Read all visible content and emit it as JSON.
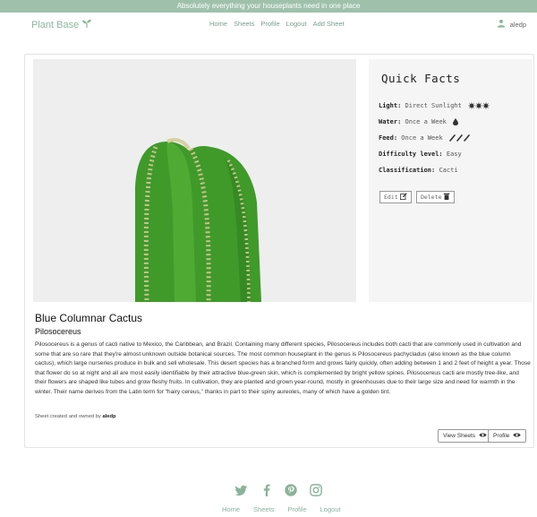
{
  "banner": {
    "text": "Absolutely everything your houseplants need in one place"
  },
  "navbar": {
    "brand": "Plant Base",
    "links": [
      "Home",
      "Sheets",
      "Profile",
      "Logout",
      "Add Sheet"
    ],
    "username": "aledp"
  },
  "facts": {
    "title": "Quick Facts",
    "light_label": "Light:",
    "light_value": "Direct Sunlight",
    "water_label": "Water:",
    "water_value": "Once a Week",
    "feed_label": "Feed:",
    "feed_value": "Once a Week",
    "difficulty_label": "Difficulty level:",
    "difficulty_value": "Easy",
    "classification_label": "Classification:",
    "classification_value": "Cacti",
    "edit_label": "Edit",
    "delete_label": "Delete"
  },
  "plant": {
    "name": "Blue Columnar Cactus",
    "latin": "Pilosocereus",
    "description": "Pilosocereus is a genus of cacti native to Mexico, the Caribbean, and Brazil. Containing many different species, Pilosocereus includes both cacti that are commonly used in cultivation and some that are so rare that they're almost unknown outside botanical sources. The most common houseplant in the genus is Pilosocereus pachycladus (also known as the blue column cactus), which large nurseries produce in bulk and sell wholesale. This desert species has a branched form and grows fairly quickly, often adding between 1 and 2 feet of height a year. Those that flower do so at night and all are most easily identifiable by their attractive blue-green skin, which is complemented by bright yellow spines. Pilosocereus cacti are mostly tree-like, and their flowers are shaped like tubes and grow fleshy fruits. In cultivation, they are planted and grown year-round, mostly in greenhouses due to their large size and need for warmth in the winter. Their name derives from the Latin term for “hairy cereus,” thanks in part to their spiny aureoles, many of which have a golden tint.",
    "owner_prefix": "Sheet created and owned by",
    "owner": "aledp"
  },
  "actions": {
    "view_sheets": "View Sheets",
    "profile": "Profile"
  },
  "footer": {
    "social": [
      "twitter-icon",
      "facebook-icon",
      "pinterest-icon",
      "instagram-icon"
    ],
    "links": [
      "Home",
      "Sheets",
      "Profile",
      "Logout"
    ]
  },
  "colors": {
    "banner": "#9fc1ab",
    "accent": "#8bb89a",
    "cactus": "#3f9a2a"
  }
}
